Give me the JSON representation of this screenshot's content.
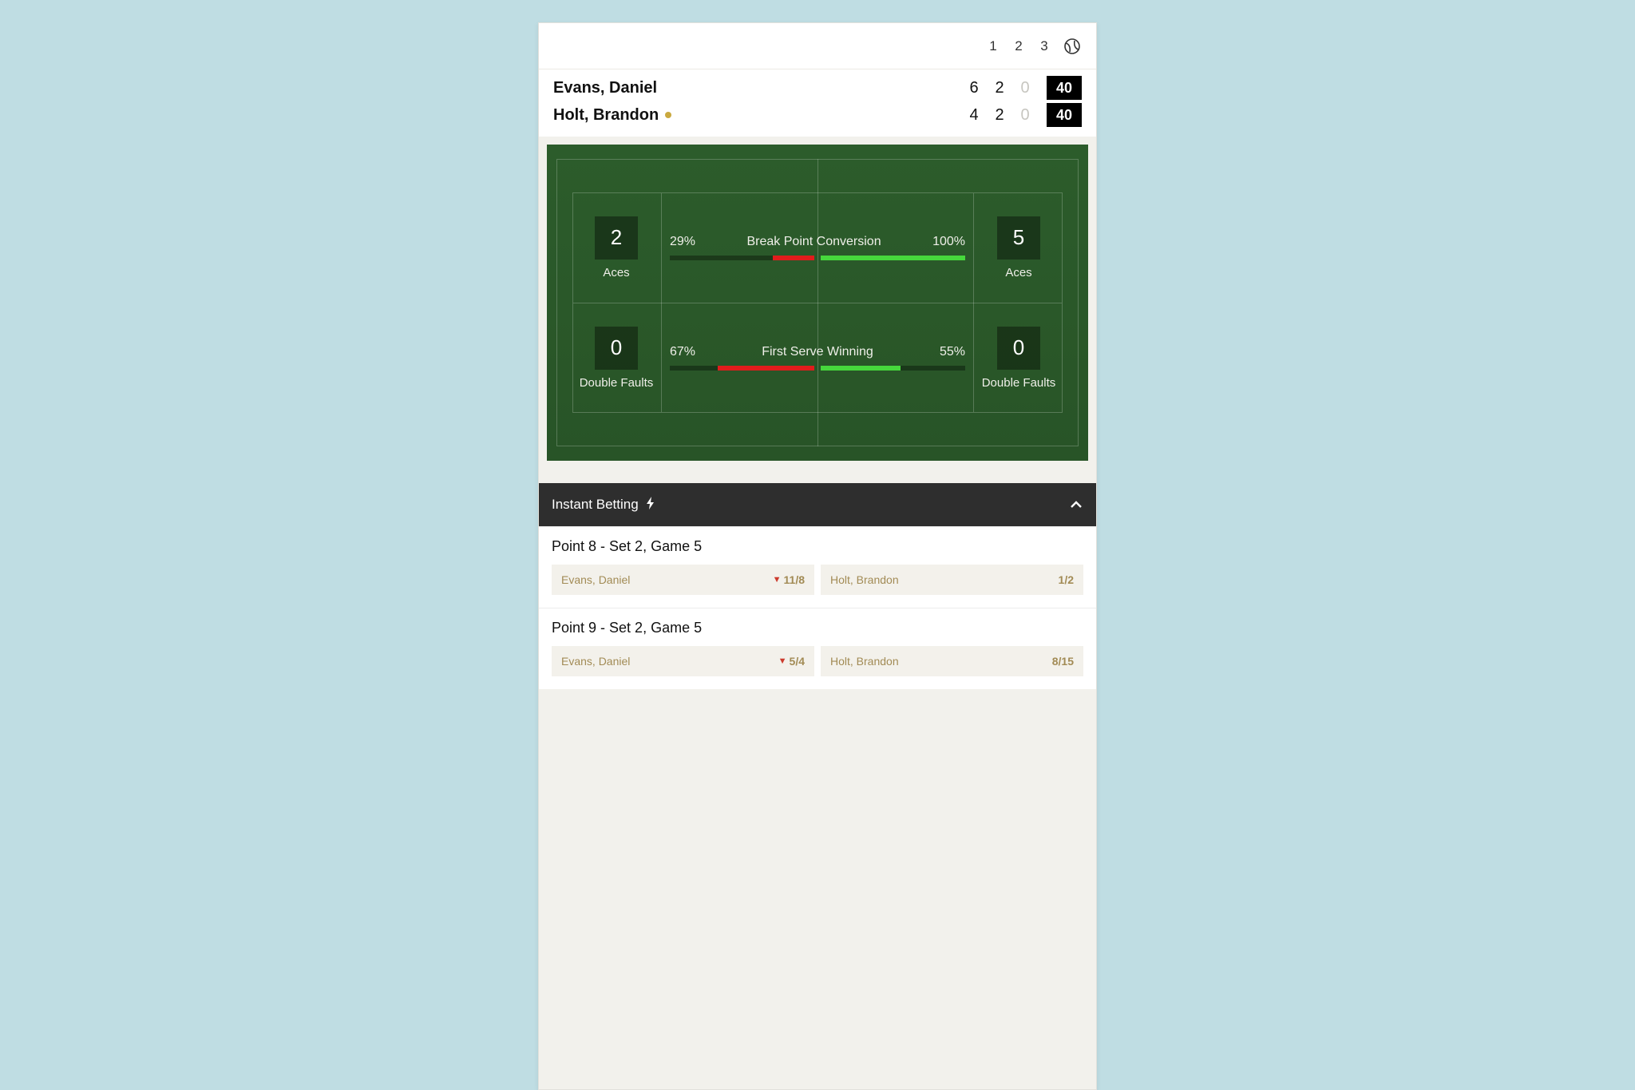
{
  "header": {
    "sets": [
      "1",
      "2",
      "3"
    ]
  },
  "players": [
    {
      "name": "Evans, Daniel",
      "serving": false,
      "sets": [
        "6",
        "2",
        "0"
      ],
      "sets_muted": [
        false,
        false,
        true
      ],
      "points": "40"
    },
    {
      "name": "Holt, Brandon",
      "serving": true,
      "sets": [
        "4",
        "2",
        "0"
      ],
      "sets_muted": [
        false,
        false,
        true
      ],
      "points": "40"
    }
  ],
  "stats": [
    {
      "left_box": {
        "value": "2",
        "label": "Aces"
      },
      "right_box": {
        "value": "5",
        "label": "Aces"
      },
      "title": "Break Point Conversion",
      "left_pct": "29%",
      "right_pct": "100%",
      "left_fill": 29,
      "right_fill": 100
    },
    {
      "left_box": {
        "value": "0",
        "label": "Double Faults"
      },
      "right_box": {
        "value": "0",
        "label": "Double Faults"
      },
      "title": "First Serve Winning",
      "left_pct": "67%",
      "right_pct": "55%",
      "left_fill": 67,
      "right_fill": 55
    }
  ],
  "betting": {
    "title": "Instant Betting",
    "blocks": [
      {
        "title": "Point 8 - Set 2, Game 5",
        "options": [
          {
            "name": "Evans, Daniel",
            "odds": "11/8",
            "move": "down"
          },
          {
            "name": "Holt, Brandon",
            "odds": "1/2",
            "move": ""
          }
        ]
      },
      {
        "title": "Point 9 - Set 2, Game 5",
        "options": [
          {
            "name": "Evans, Daniel",
            "odds": "5/4",
            "move": "down"
          },
          {
            "name": "Holt, Brandon",
            "odds": "8/15",
            "move": ""
          }
        ]
      }
    ]
  }
}
